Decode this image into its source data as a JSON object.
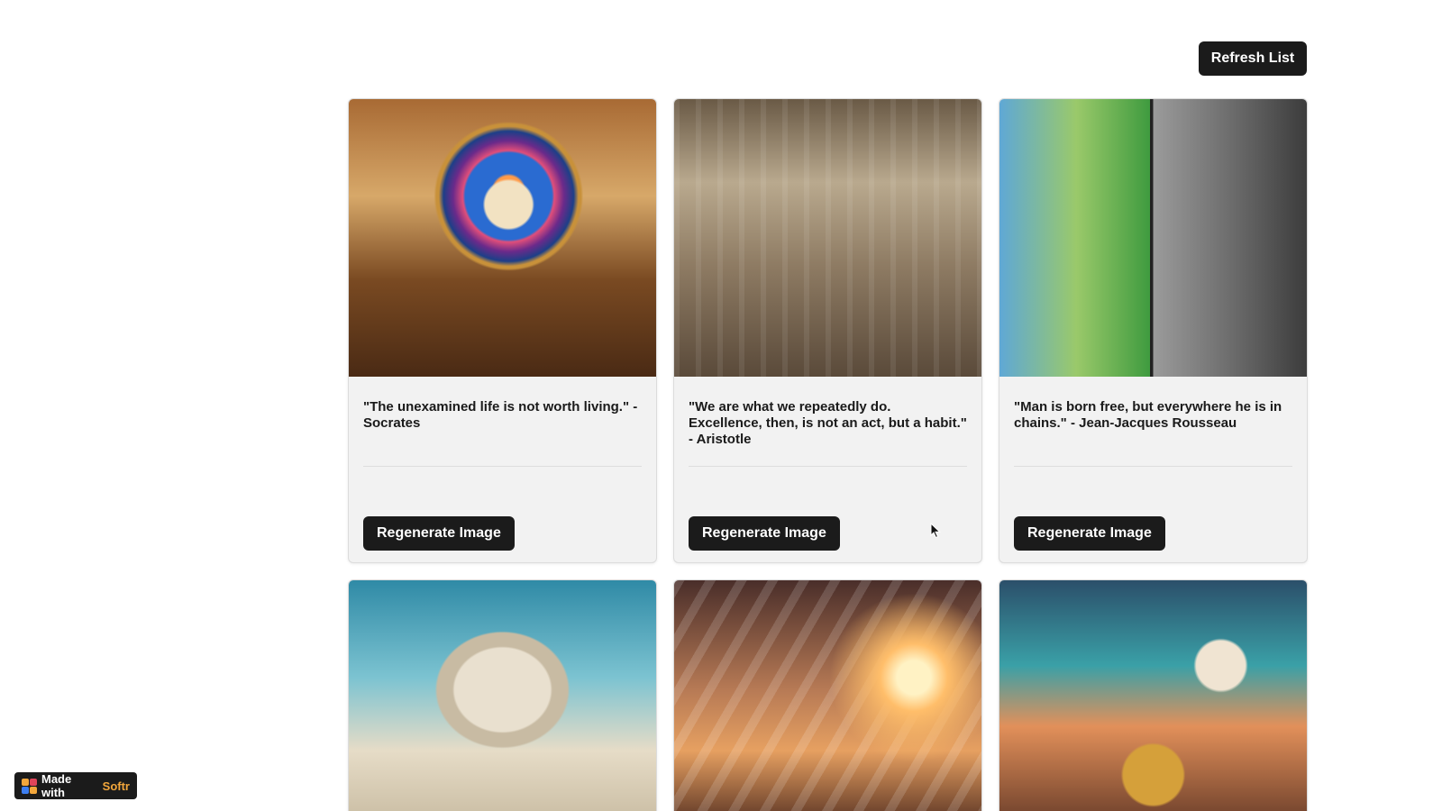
{
  "header": {
    "refresh_label": "Refresh List"
  },
  "cards": [
    {
      "quote": "\"The unexamined life is not worth living.\" - Socrates",
      "button_label": "Regenerate Image"
    },
    {
      "quote": "\"We are what we repeatedly do. Excellence, then, is not an act, but a habit.\" - Aristotle",
      "button_label": "Regenerate Image"
    },
    {
      "quote": "\"Man is born free, but everywhere he is in chains.\" - Jean-Jacques Rousseau",
      "button_label": "Regenerate Image"
    }
  ],
  "badge": {
    "prefix": "Made with",
    "brand": "Softr",
    "brand_color": "#f2a63b"
  },
  "colors": {
    "button_bg": "#1b1b1b",
    "card_bg": "#f2f2f2"
  }
}
